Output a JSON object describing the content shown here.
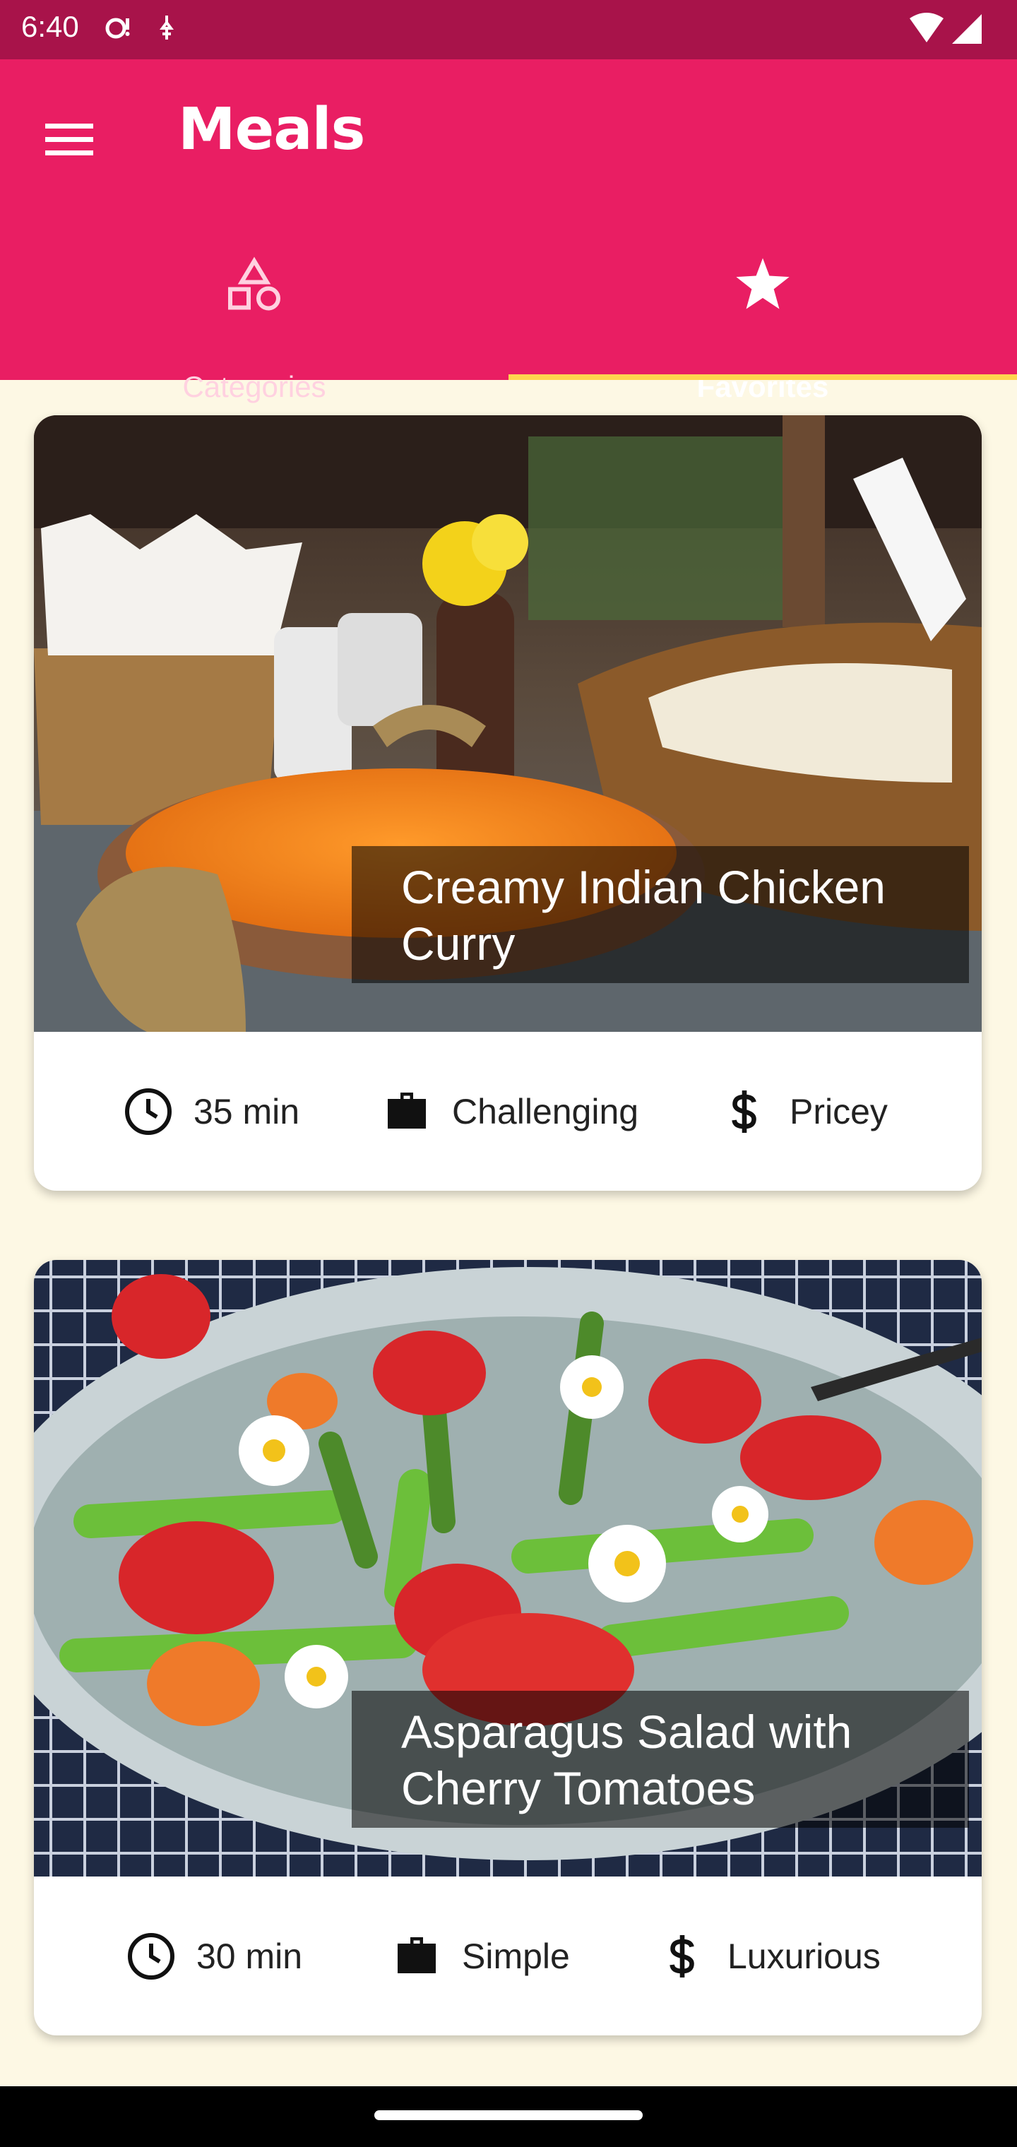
{
  "status_bar": {
    "time": "6:40"
  },
  "appbar": {
    "title": "Meals",
    "menu_icon": "hamburger-menu-icon"
  },
  "tabs": [
    {
      "label": "Categories",
      "icon": "category-shapes-icon",
      "selected": false
    },
    {
      "label": "Favorites",
      "icon": "star-icon",
      "selected": true
    }
  ],
  "colors": {
    "primary": "#e91e63",
    "primary_dark": "#a8134a",
    "accent": "#ffd54f",
    "background": "#fdf8e4"
  },
  "meals": [
    {
      "title": "Creamy Indian Chicken Curry",
      "duration": "35 min",
      "complexity": "Challenging",
      "affordability": "Pricey"
    },
    {
      "title": "Asparagus Salad with Cherry Tomatoes",
      "duration": "30 min",
      "complexity": "Simple",
      "affordability": "Luxurious"
    }
  ]
}
